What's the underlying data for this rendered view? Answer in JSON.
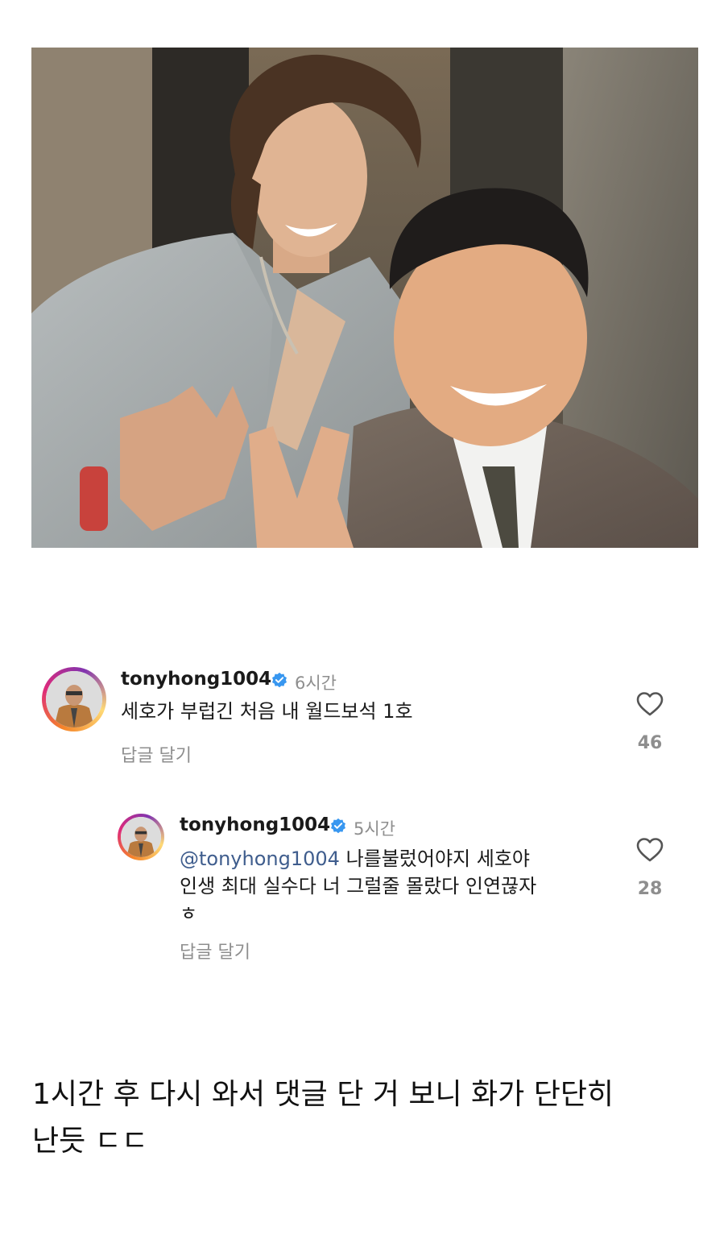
{
  "comments": [
    {
      "username": "tonyhong1004",
      "time": "6시간",
      "text": "세호가 부럽긴 처음  내 월드보석 1호",
      "reply_label": "답글 달기",
      "likes": "46"
    },
    {
      "username": "tonyhong1004",
      "time": "5시간",
      "mention": "@tonyhong1004",
      "text_line1": " 나를불렀어야지 세호야",
      "text_line2": "인생 최대 실수다  너 그럴줄 몰랐다  인연끊자",
      "text_line3": "ㅎ",
      "reply_label": "답글 달기",
      "likes": "28"
    }
  ],
  "caption": {
    "line1": "1시간 후 다시 와서 댓글 단 거 보니 화가 단단히",
    "line2": "난듯 ㄷㄷ"
  },
  "colors": {
    "mention": "#3f5d8d",
    "verified": "#3897f0",
    "muted": "#8e8e8e"
  },
  "icons": {
    "verified": "verified-badge-icon",
    "like": "heart-outline-icon"
  }
}
